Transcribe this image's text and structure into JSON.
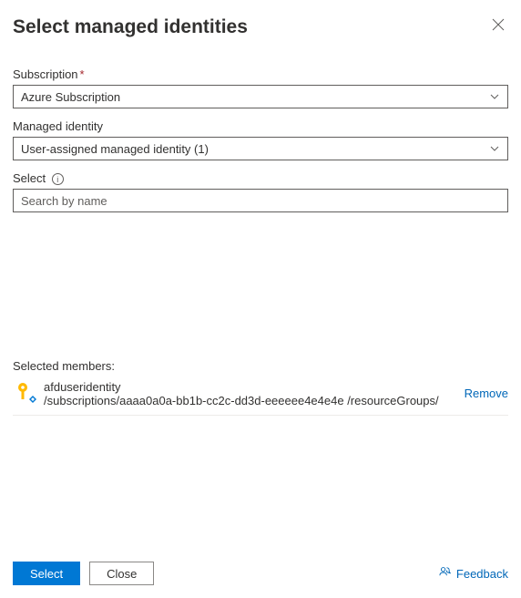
{
  "header": {
    "title": "Select managed identities"
  },
  "fields": {
    "subscription": {
      "label": "Subscription",
      "required_marker": "*",
      "value": "Azure Subscription"
    },
    "managed_identity": {
      "label": "Managed identity",
      "value": "User-assigned managed identity (1)"
    },
    "select": {
      "label": "Select",
      "placeholder": "Search by name",
      "value": ""
    }
  },
  "selected": {
    "label": "Selected members:",
    "members": [
      {
        "name": "afduseridentity",
        "path": "/subscriptions/aaaa0a0a-bb1b-cc2c-dd3d-eeeeee4e4e4e /resourceGroups/",
        "remove_label": "Remove"
      }
    ]
  },
  "footer": {
    "select_label": "Select",
    "close_label": "Close",
    "feedback_label": "Feedback"
  }
}
